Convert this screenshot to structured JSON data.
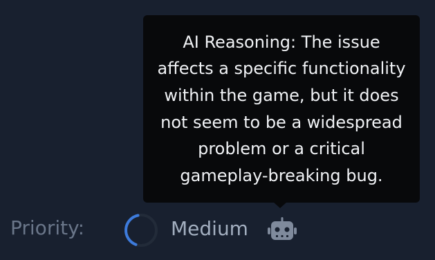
{
  "tooltip": {
    "lines": [
      "AI Reasoning: The issue",
      "affects a specific functionality",
      "within the game, but it does",
      "not seem to be a widespread",
      "problem or a critical",
      "gameplay-breaking bug."
    ]
  },
  "priority": {
    "label": "Priority:",
    "value": "Medium",
    "indicator_icon": "loading-spinner-icon",
    "ai_icon": "robot-icon"
  },
  "colors": {
    "background": "#18202f",
    "tooltip_bg": "#08090b",
    "accent": "#3d7bdc"
  }
}
